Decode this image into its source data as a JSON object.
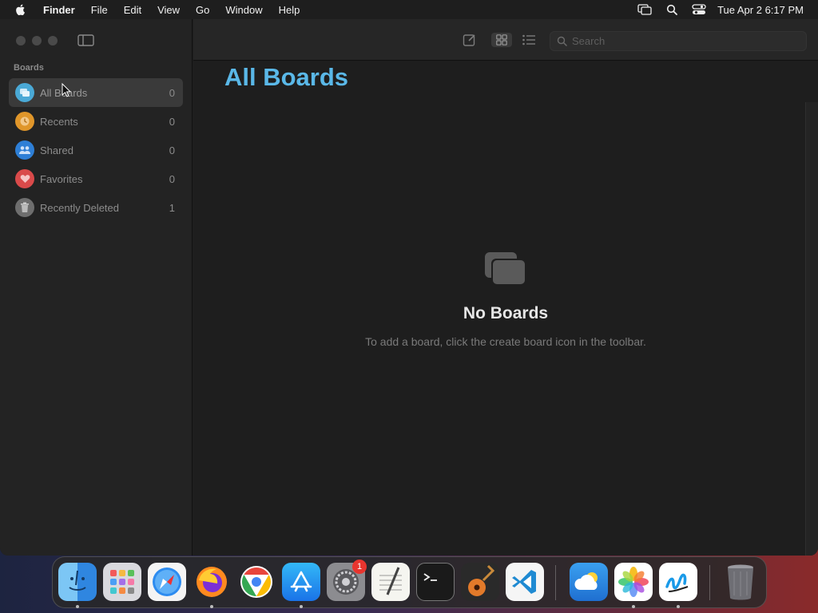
{
  "menubar": {
    "app_name": "Finder",
    "items": [
      "File",
      "Edit",
      "View",
      "Go",
      "Window",
      "Help"
    ],
    "clock": "Tue Apr 2  6:17 PM",
    "icons": [
      "screen-mirroring-icon",
      "spotlight-search-icon",
      "control-center-icon"
    ]
  },
  "sidebar": {
    "section_title": "Boards",
    "items": [
      {
        "label": "All Boards",
        "count": "0",
        "icon": "all-boards-icon",
        "color": "#4aa9d6"
      },
      {
        "label": "Recents",
        "count": "0",
        "icon": "clock-icon",
        "color": "#e0962a"
      },
      {
        "label": "Shared",
        "count": "0",
        "icon": "people-icon",
        "color": "#2e7fd6"
      },
      {
        "label": "Favorites",
        "count": "0",
        "icon": "heart-icon",
        "color": "#d94a4a"
      },
      {
        "label": "Recently Deleted",
        "count": "1",
        "icon": "trash-icon",
        "color": "#8a8a8a"
      }
    ]
  },
  "toolbar": {
    "search_placeholder": "Search"
  },
  "main": {
    "title": "All Boards",
    "empty_title": "No Boards",
    "empty_subtitle": "To add a board, click the create board icon in the toolbar."
  },
  "dock": {
    "apps": [
      {
        "name": "Finder",
        "running": true
      },
      {
        "name": "Launchpad",
        "running": false
      },
      {
        "name": "Safari",
        "running": false
      },
      {
        "name": "Firefox",
        "running": true
      },
      {
        "name": "Chrome",
        "running": false
      },
      {
        "name": "App Store",
        "running": true
      },
      {
        "name": "System Settings",
        "running": false,
        "badge": "1"
      },
      {
        "name": "TextEdit",
        "running": false
      },
      {
        "name": "Terminal",
        "running": false
      },
      {
        "name": "GarageBand",
        "running": false
      },
      {
        "name": "VS Code",
        "running": false
      },
      {
        "name": "Weather",
        "running": false
      },
      {
        "name": "Photos",
        "running": true
      },
      {
        "name": "Freeform",
        "running": true
      },
      {
        "name": "Trash",
        "running": false
      }
    ]
  }
}
